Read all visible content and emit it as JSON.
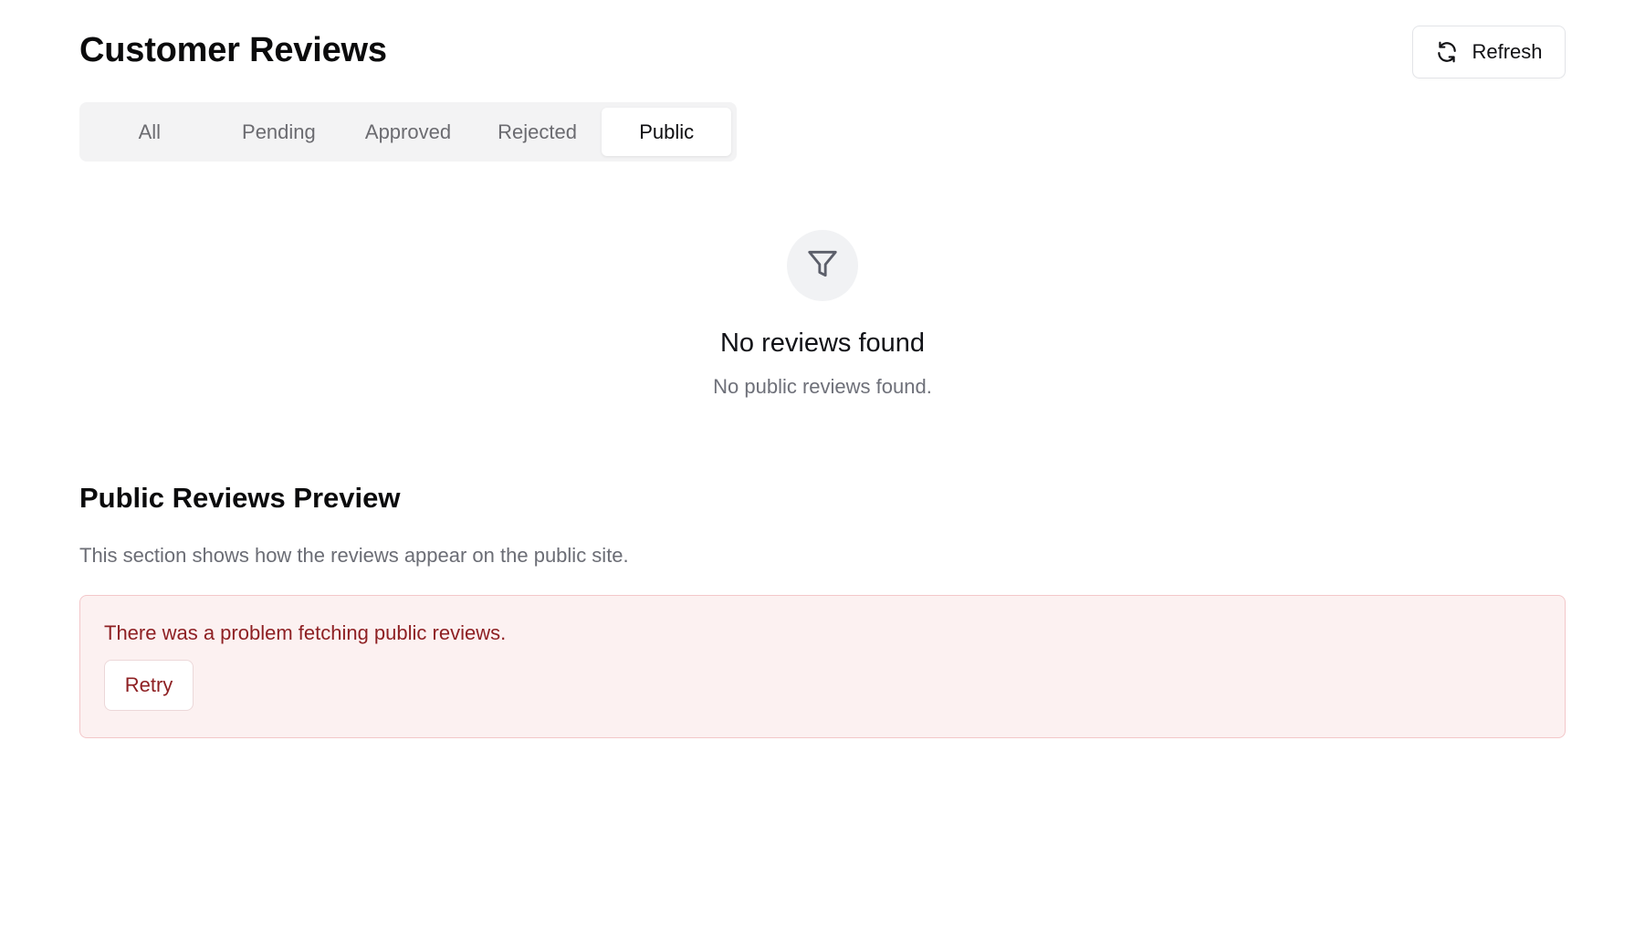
{
  "header": {
    "title": "Customer Reviews",
    "refresh_label": "Refresh",
    "refresh_icon": "refresh-icon"
  },
  "tabs": [
    {
      "label": "All",
      "active": false
    },
    {
      "label": "Pending",
      "active": false
    },
    {
      "label": "Approved",
      "active": false
    },
    {
      "label": "Rejected",
      "active": false
    },
    {
      "label": "Public",
      "active": true
    }
  ],
  "empty_state": {
    "icon": "filter-icon",
    "title": "No reviews found",
    "subtitle": "No public reviews found."
  },
  "preview": {
    "title": "Public Reviews Preview",
    "description": "This section shows how the reviews appear on the public site.",
    "error": {
      "message": "There was a problem fetching public reviews.",
      "retry_label": "Retry"
    }
  },
  "colors": {
    "error_text": "#8e2023",
    "error_bg": "#fcf1f1",
    "error_border": "#f3c7c9",
    "tab_bg": "#f3f3f4",
    "muted_text": "#6b6d75"
  }
}
